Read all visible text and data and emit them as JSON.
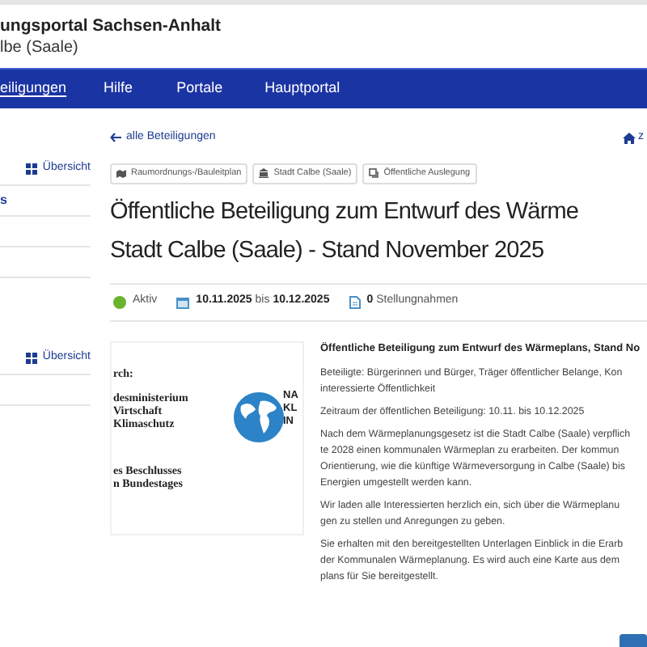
{
  "header": {
    "title": "ungsportal Sachsen-Anhalt",
    "subtitle": "lbe (Saale)"
  },
  "nav": [
    {
      "label": "eiligungen",
      "selected": true
    },
    {
      "label": "Hilfe",
      "selected": false
    },
    {
      "label": "Portale",
      "selected": false
    },
    {
      "label": "Hauptportal",
      "selected": false
    }
  ],
  "sidebar": {
    "sections": [
      {
        "overview": "Übersicht",
        "items": [
          {
            "label": "s"
          }
        ]
      },
      {
        "overview": "Übersicht"
      }
    ]
  },
  "back_link": "alle Beteiligungen",
  "home_link": "z",
  "tags": [
    {
      "kind": "map",
      "label": "Raumordnungs-/Bauleitplan"
    },
    {
      "kind": "building",
      "label": "Stadt Calbe (Saale)"
    },
    {
      "kind": "copy",
      "label": "Öffentliche Auslegung"
    }
  ],
  "title_lines": [
    "Öffentliche Beteiligung zum Entwurf des Wärme",
    "Stadt Calbe (Saale) - Stand November 2025"
  ],
  "status": {
    "label": "Aktiv",
    "color": "#6ab42d",
    "date_from": "10.11.2025",
    "date_sep": "bis",
    "date_to": "10.12.2025",
    "comments_count": "0",
    "comments_label": "Stellungnahmen"
  },
  "logo": {
    "lines_top": [
      "rch:",
      "desministerium",
      "Virtschaft",
      "Klimaschutz"
    ],
    "lines_right": [
      "NA",
      "KL",
      "IN"
    ],
    "lines_bottom": [
      "es Beschlusses",
      "n Bundestages"
    ]
  },
  "content": {
    "heading": "Öffentliche Beteiligung zum Entwurf des Wärmeplans, Stand No",
    "paragraphs": [
      [
        "Beteiligte: Bürgerinnen und Bürger, Träger öffentlicher Belange, Kon",
        "interessierte Öffentlichkeit"
      ],
      [
        "Zeitraum der öffentlichen Beteiligung: 10.11. bis 10.12.2025"
      ],
      [
        "Nach dem Wärmeplanungsgesetz ist die Stadt Calbe (Saale) verpflich",
        "te 2028 einen kommunalen Wärmeplan zu erarbeiten. Der kommun",
        "Orientierung, wie die künftige Wärmeversorgung in Calbe (Saale) bis",
        "Energien umgestellt werden kann."
      ],
      [
        "Wir laden alle Interessierten herzlich ein, sich über die Wärmeplanu",
        "gen zu stellen und Anregungen zu geben."
      ],
      [
        "Sie erhalten mit den bereitgestellten Unterlagen Einblick in die Erarb",
        "der Kommunalen Wärmeplanung. Es wird auch eine Karte aus dem",
        "plans für Sie bereitgestellt."
      ]
    ]
  }
}
